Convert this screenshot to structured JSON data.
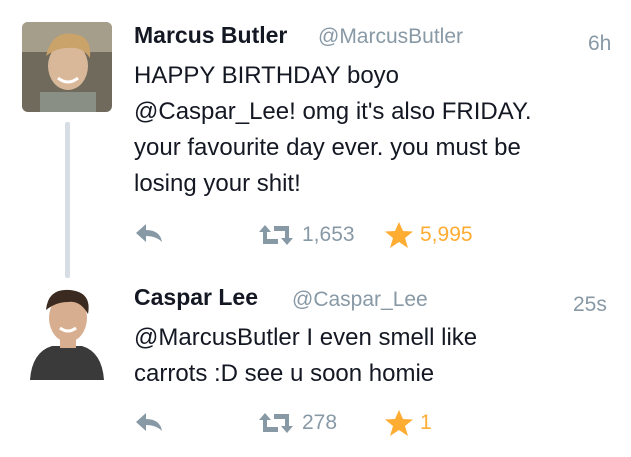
{
  "tweets": [
    {
      "name": "Marcus Butler",
      "handle": "@MarcusButler",
      "time": "6h",
      "text": "HAPPY BIRTHDAY boyo\n@Caspar_Lee! omg it's also FRIDAY.\nyour favourite day ever. you must be\nlosing your shit!",
      "retweets": "1,653",
      "favorites": "5,995"
    },
    {
      "name": "Caspar Lee",
      "handle": "@Caspar_Lee",
      "time": "25s",
      "text": "@MarcusButler I even smell like\ncarrots :D see u soon homie",
      "retweets": "278",
      "favorites": "1"
    }
  ],
  "colors": {
    "accent_favorite": "#ffac33",
    "muted": "#8899a6",
    "text": "#141823"
  },
  "icons": {
    "reply": "reply-icon",
    "retweet": "retweet-icon",
    "favorite": "star-icon"
  }
}
